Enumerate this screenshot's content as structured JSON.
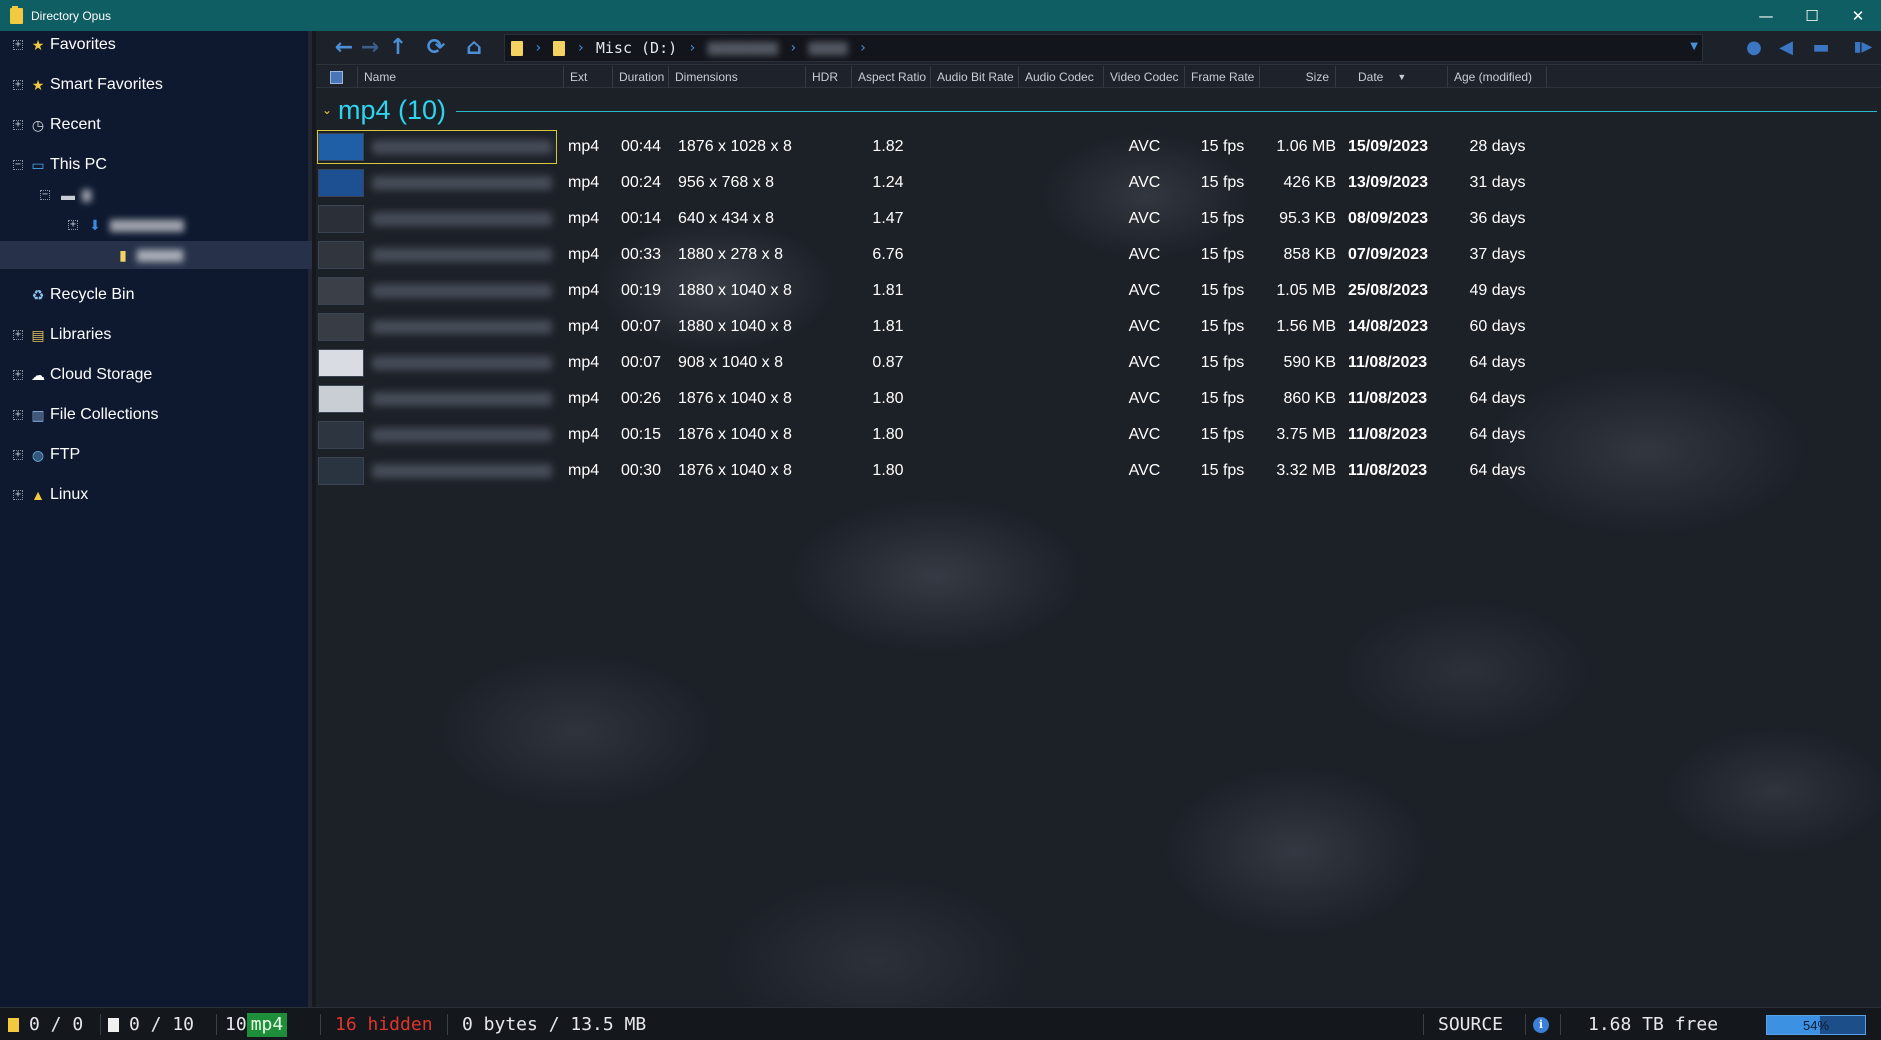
{
  "window": {
    "title": "Directory Opus",
    "minimize_glyph": "—",
    "maximize_glyph": "☐",
    "close_glyph": "✕"
  },
  "tree": {
    "items": [
      {
        "label": "Favorites",
        "icon": "star-icon"
      },
      {
        "label": "Smart Favorites",
        "icon": "star-icon"
      },
      {
        "label": "Recent",
        "icon": "recent-icon"
      },
      {
        "label": "This PC",
        "icon": "computer-icon"
      },
      {
        "label": "",
        "icon": "drive-icon"
      },
      {
        "label": "",
        "icon": "downloads-icon"
      },
      {
        "label": "",
        "icon": "folder-icon"
      },
      {
        "label": "Recycle Bin",
        "icon": "recycle-bin-icon"
      },
      {
        "label": "Libraries",
        "icon": "libraries-icon"
      },
      {
        "label": "Cloud Storage",
        "icon": "cloud-icon"
      },
      {
        "label": "File Collections",
        "icon": "collections-icon"
      },
      {
        "label": "FTP",
        "icon": "ftp-icon"
      },
      {
        "label": "Linux",
        "icon": "linux-icon"
      }
    ]
  },
  "toolbar": {
    "path": {
      "drive": "Misc (D:)",
      "sep": "›"
    },
    "icons": [
      "back-icon",
      "forward-icon",
      "up-icon",
      "refresh-icon",
      "home-icon"
    ]
  },
  "columns": {
    "name": "Name",
    "ext": "Ext",
    "duration": "Duration",
    "dimensions": "Dimensions",
    "hdr": "HDR",
    "aspect": "Aspect Ratio",
    "audio_bitrate": "Audio Bit Rate",
    "audio_codec": "Audio Codec",
    "video_codec": "Video Codec",
    "frame_rate": "Frame Rate",
    "size": "Size",
    "date": "Date",
    "age": "Age (modified)",
    "sort_indicator": "▼"
  },
  "group": {
    "label": "mp4 (10)",
    "chevron": "⌄"
  },
  "files": [
    {
      "ext": "mp4",
      "duration": "00:44",
      "dimensions": "1876 x 1028 x 8",
      "aspect": "1.82",
      "video_codec": "AVC",
      "frame_rate": "15 fps",
      "size": "1.06 MB",
      "date": "15/09/2023",
      "age": "28 days",
      "thumb_color": "#1f5fa8"
    },
    {
      "ext": "mp4",
      "duration": "00:24",
      "dimensions": "956 x 768 x 8",
      "aspect": "1.24",
      "video_codec": "AVC",
      "frame_rate": "15 fps",
      "size": "426 KB",
      "date": "13/09/2023",
      "age": "31 days",
      "thumb_color": "#1d4f93"
    },
    {
      "ext": "mp4",
      "duration": "00:14",
      "dimensions": "640 x 434 x 8",
      "aspect": "1.47",
      "video_codec": "AVC",
      "frame_rate": "15 fps",
      "size": "95.3 KB",
      "date": "08/09/2023",
      "age": "36 days",
      "thumb_color": "#2a2f38"
    },
    {
      "ext": "mp4",
      "duration": "00:33",
      "dimensions": "1880 x 278 x 8",
      "aspect": "6.76",
      "video_codec": "AVC",
      "frame_rate": "15 fps",
      "size": "858 KB",
      "date": "07/09/2023",
      "age": "37 days",
      "thumb_color": "#30353e"
    },
    {
      "ext": "mp4",
      "duration": "00:19",
      "dimensions": "1880 x 1040 x 8",
      "aspect": "1.81",
      "video_codec": "AVC",
      "frame_rate": "15 fps",
      "size": "1.05 MB",
      "date": "25/08/2023",
      "age": "49 days",
      "thumb_color": "#3a3f48"
    },
    {
      "ext": "mp4",
      "duration": "00:07",
      "dimensions": "1880 x 1040 x 8",
      "aspect": "1.81",
      "video_codec": "AVC",
      "frame_rate": "15 fps",
      "size": "1.56 MB",
      "date": "14/08/2023",
      "age": "60 days",
      "thumb_color": "#383c44"
    },
    {
      "ext": "mp4",
      "duration": "00:07",
      "dimensions": "908 x 1040 x 8",
      "aspect": "0.87",
      "video_codec": "AVC",
      "frame_rate": "15 fps",
      "size": "590 KB",
      "date": "11/08/2023",
      "age": "64 days",
      "thumb_color": "#d9dde3"
    },
    {
      "ext": "mp4",
      "duration": "00:26",
      "dimensions": "1876 x 1040 x 8",
      "aspect": "1.80",
      "video_codec": "AVC",
      "frame_rate": "15 fps",
      "size": "860 KB",
      "date": "11/08/2023",
      "age": "64 days",
      "thumb_color": "#c9cdd4"
    },
    {
      "ext": "mp4",
      "duration": "00:15",
      "dimensions": "1876 x 1040 x 8",
      "aspect": "1.80",
      "video_codec": "AVC",
      "frame_rate": "15 fps",
      "size": "3.75 MB",
      "date": "11/08/2023",
      "age": "64 days",
      "thumb_color": "#2c3540"
    },
    {
      "ext": "mp4",
      "duration": "00:30",
      "dimensions": "1876 x 1040 x 8",
      "aspect": "1.80",
      "video_codec": "AVC",
      "frame_rate": "15 fps",
      "size": "3.32 MB",
      "date": "11/08/2023",
      "age": "64 days",
      "thumb_color": "#2a3440"
    }
  ],
  "status": {
    "folders": "0 / 0",
    "files": "0 / 10",
    "count": "10",
    "type_badge": "mp4",
    "hidden": "16 hidden",
    "bytes": "0 bytes / 13.5 MB",
    "source": "SOURCE",
    "free": "1.68 TB free",
    "usage_percent": 54,
    "usage_label": "54%"
  },
  "colors": {
    "accent": "#2ed3ec",
    "hidden_text": "#e0352b",
    "badge_green": "#1e8e3a",
    "titlebar": "#0f5e63"
  }
}
